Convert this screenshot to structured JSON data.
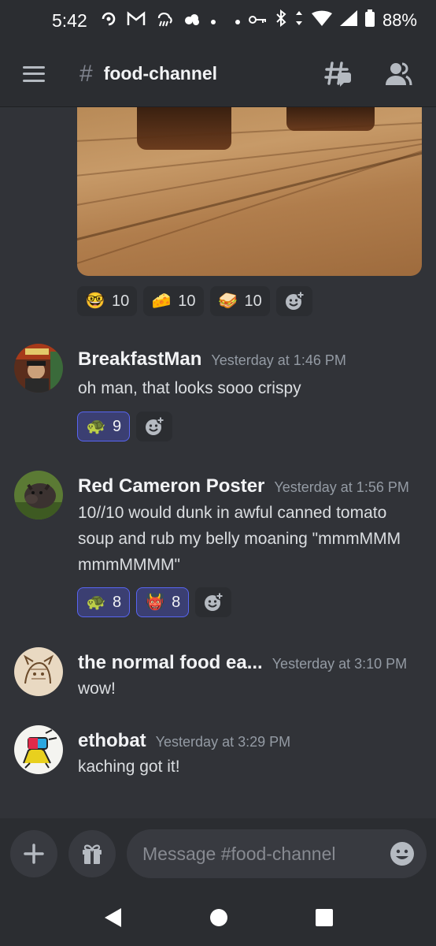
{
  "status_bar": {
    "time": "5:42",
    "battery": "88%",
    "left_icons": [
      "sync-icon",
      "gmail-icon",
      "weather-icon",
      "cloud-icon",
      "dot-icon"
    ],
    "right_icons": [
      "dot-icon",
      "key-icon",
      "bluetooth-icon",
      "data-arrows-icon",
      "wifi-icon",
      "signal-icon",
      "battery-icon"
    ]
  },
  "header": {
    "channel_name": "food-channel",
    "hash": "#"
  },
  "top_reactions": [
    {
      "emoji": "🤓",
      "count": "10"
    },
    {
      "emoji": "🧀",
      "count": "10"
    },
    {
      "emoji": "🥪",
      "count": "10"
    }
  ],
  "messages": [
    {
      "username": "BreakfastMan",
      "timestamp": "Yesterday at 1:46 PM",
      "text": "oh man, that looks sooo crispy",
      "reactions": [
        {
          "emoji": "🐢",
          "count": "9"
        }
      ]
    },
    {
      "username": "Red Cameron Poster",
      "timestamp": "Yesterday at 1:56 PM",
      "text": "10//10 would dunk in awful canned tomato soup and rub my belly moaning \"mmmMMM mmmMMMM\"",
      "reactions": [
        {
          "emoji": "🐢",
          "count": "8"
        },
        {
          "emoji": "👹",
          "count": "8"
        }
      ]
    },
    {
      "username": "the normal food ea...",
      "timestamp": "Yesterday at 3:10 PM",
      "text": "wow!"
    },
    {
      "username": "ethobat",
      "timestamp": "Yesterday at 3:29 PM",
      "text": "kaching got it!"
    }
  ],
  "composer": {
    "placeholder": "Message #food-channel"
  },
  "colors": {
    "background": "#313338",
    "header": "#2b2d31",
    "accent": "#5865f2"
  }
}
